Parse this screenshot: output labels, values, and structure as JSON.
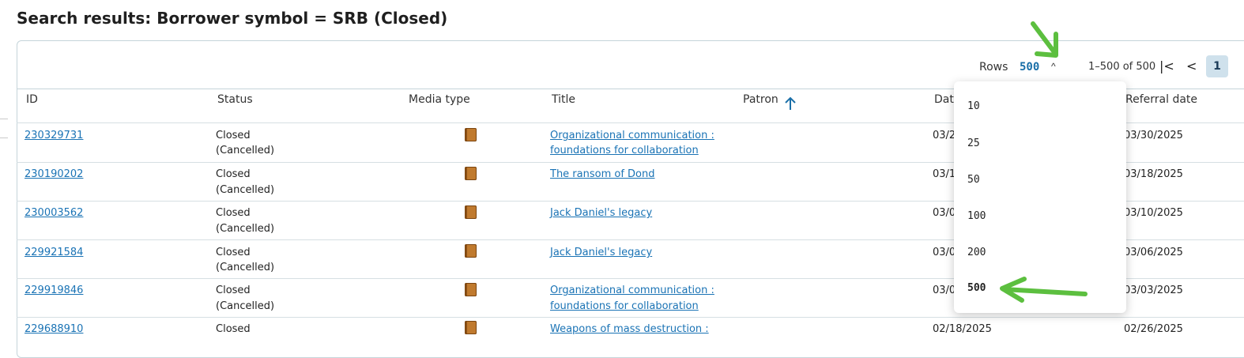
{
  "page": {
    "title": "Search results: Borrower symbol = SRB (Closed)"
  },
  "toolbar": {
    "rows_label": "Rows",
    "rows_value": "500",
    "caret": "^",
    "range_text": "1–500 of 500",
    "first_page": "|<",
    "prev_page": "<",
    "current_page": "1"
  },
  "columns": [
    "ID",
    "Status",
    "Media type",
    "Title",
    "Patron",
    "Date",
    "Referral date"
  ],
  "rows": [
    {
      "id": "230329731",
      "status1": "Closed",
      "status2": "(Cancelled)",
      "title1": "Organizational communication :",
      "title2": "foundations for collaboration",
      "date": "03/2",
      "referral": "03/30/2025"
    },
    {
      "id": "230190202",
      "status1": "Closed",
      "status2": "(Cancelled)",
      "title1": "The ransom of Dond",
      "title2": "",
      "date": "03/1",
      "referral": "03/18/2025"
    },
    {
      "id": "230003562",
      "status1": "Closed",
      "status2": "(Cancelled)",
      "title1": "Jack Daniel's legacy",
      "title2": "",
      "date": "03/0",
      "referral": "03/10/2025"
    },
    {
      "id": "229921584",
      "status1": "Closed",
      "status2": "(Cancelled)",
      "title1": "Jack Daniel's legacy",
      "title2": "",
      "date": "03/0",
      "referral": "03/06/2025"
    },
    {
      "id": "229919846",
      "status1": "Closed",
      "status2": "(Cancelled)",
      "title1": "Organizational communication :",
      "title2": "foundations for collaboration",
      "date": "03/0",
      "referral": "03/03/2025"
    },
    {
      "id": "229688910",
      "status1": "Closed",
      "status2": "",
      "title1": "Weapons of mass destruction :",
      "title2": "",
      "date": "02/18/2025",
      "referral": "02/26/2025"
    }
  ],
  "dropdown": {
    "options": [
      "10",
      "25",
      "50",
      "100",
      "200",
      "500"
    ],
    "selected": "500"
  },
  "icons": {
    "media": "book-icon",
    "sort": "arrow-up-icon"
  },
  "colors": {
    "link": "#1a73b5",
    "accent": "#1a6fa8",
    "annotation_arrow": "#5cbf3f",
    "page_chip": "#cfe1ec"
  }
}
